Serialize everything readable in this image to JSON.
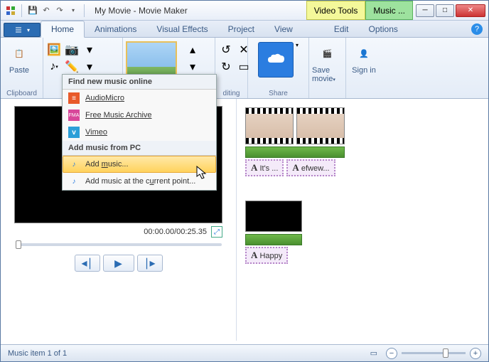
{
  "title": "My Movie - Movie Maker",
  "context_tabs": {
    "video": "Video Tools",
    "music": "Music ..."
  },
  "ribbon_tabs": {
    "home": "Home",
    "animations": "Animations",
    "visual_effects": "Visual Effects",
    "project": "Project",
    "view": "View",
    "edit": "Edit",
    "options": "Options"
  },
  "groups": {
    "clipboard": "Clipboard",
    "editing": "diting",
    "share": "Share"
  },
  "buttons": {
    "paste": "Paste",
    "save_movie": "Save movie",
    "sign_in": "Sign in"
  },
  "dropdown": {
    "header1": "Find new music online",
    "audiomicro": "AudioMicro",
    "freemusic": "Free Music Archive",
    "vimeo": "Vimeo",
    "header2": "Add music from PC",
    "add_music": "Add music...",
    "add_current": "Add music at the current point..."
  },
  "preview": {
    "time": "00:00.00/00:25.35"
  },
  "timeline": {
    "caption1": "It's ...",
    "caption2": "efwew...",
    "caption3": "Happy"
  },
  "statusbar": {
    "status": "Music item 1 of 1"
  }
}
